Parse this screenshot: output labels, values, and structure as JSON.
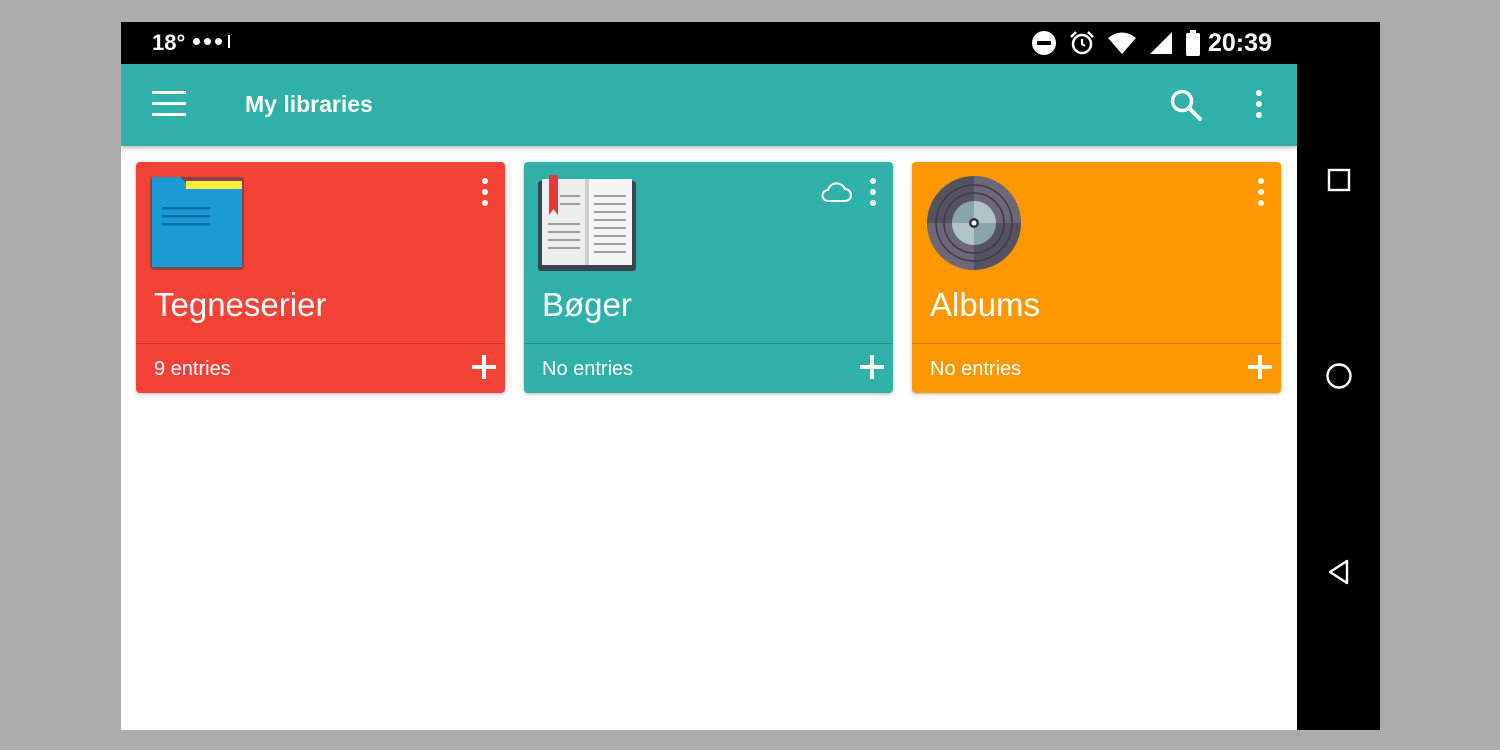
{
  "status_bar": {
    "temperature": "18°",
    "time": "20:39",
    "icons": [
      "do-not-disturb-icon",
      "alarm-icon",
      "wifi-icon",
      "signal-icon",
      "battery-icon"
    ]
  },
  "app_bar": {
    "title": "My libraries",
    "background": "#2fb0a8",
    "icons": [
      "menu-icon",
      "search-icon",
      "more-vert-icon"
    ]
  },
  "libraries": [
    {
      "name": "Tegneserier",
      "entries": "9 entries",
      "color": "#f44336",
      "cover_icon": "folder-icon",
      "synced": false
    },
    {
      "name": "Bøger",
      "entries": "No entries",
      "color": "#2fb0a8",
      "cover_icon": "book-icon",
      "synced": true
    },
    {
      "name": "Albums",
      "entries": "No entries",
      "color": "#ff9800",
      "cover_icon": "vinyl-record-icon",
      "synced": false
    }
  ],
  "nav_bar": {
    "icons": [
      "recents-icon",
      "home-icon",
      "back-icon"
    ]
  }
}
